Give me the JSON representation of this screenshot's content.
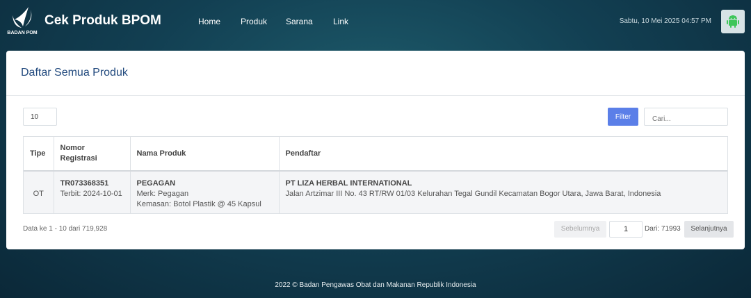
{
  "header": {
    "logo_text": "BADAN POM",
    "brand": "Cek Produk BPOM",
    "nav": [
      "Home",
      "Produk",
      "Sarana",
      "Link"
    ],
    "datetime": "Sabtu, 10 Mei 2025 04:57 PM",
    "android_icon": "android-icon"
  },
  "card": {
    "title": "Daftar Semua Produk",
    "page_length": "10",
    "filter_label": "Filter",
    "search_placeholder": "Cari..."
  },
  "table": {
    "headers": [
      "Tipe",
      "Nomor Registrasi",
      "Nama Produk",
      "Pendaftar"
    ],
    "rows": [
      {
        "tipe": "OT",
        "nomor": "TR073368351",
        "terbit": "Terbit: 2024-10-01",
        "nama": "PEGAGAN",
        "merk": "Merk: Pegagan",
        "kemasan": "Kemasan: Botol Plastik @ 45 Kapsul",
        "pendaftar": "PT LIZA HERBAL INTERNATIONAL",
        "alamat": "Jalan Artzimar III No. 43 RT/RW 01/03 Kelurahan Tegal Gundil Kecamatan Bogor Utara, Jawa Barat, Indonesia"
      }
    ]
  },
  "pagination": {
    "info": "Data ke 1 - 10 dari 719,928",
    "prev_label": "Sebelumnya",
    "current_page": "1",
    "total_label": "Dari: 71993",
    "next_label": "Selanjutnya"
  },
  "footer": {
    "text": "2022 ©  Badan Pengawas Obat dan Makanan Republik Indonesia"
  },
  "colors": {
    "brand_blue": "#224a7e",
    "filter_button": "#5b7fe8",
    "android_green": "#3ec65a"
  }
}
